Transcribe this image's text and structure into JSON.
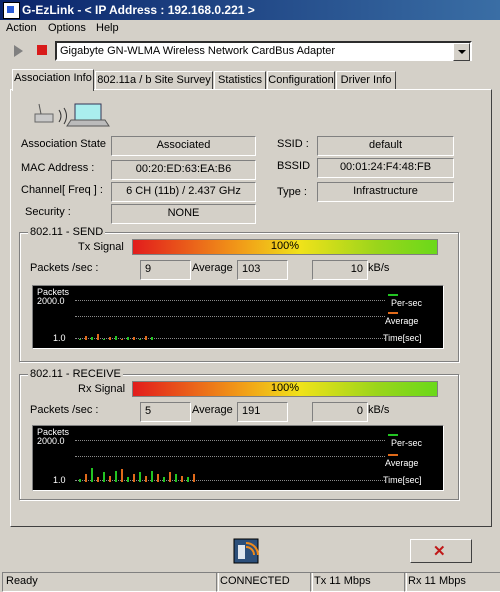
{
  "window": {
    "title": "G-EzLink  -  < IP Address : 192.168.0.221  >"
  },
  "menu": [
    "Action",
    "Options",
    "Help"
  ],
  "toolbar": {
    "adapter": "Gigabyte GN-WLMA Wireless Network CardBus Adapter"
  },
  "tabs": [
    "Association Info",
    "802.11a / b Site Survey",
    "Statistics",
    "Configuration",
    "Driver Info"
  ],
  "association": {
    "state_label": "Association State",
    "state": "Associated",
    "mac_label": "MAC Address :",
    "mac": "00:20:ED:63:EA:B6",
    "channel_label": "Channel[ Freq ] :",
    "channel": "6 CH (11b) / 2.437 GHz",
    "security_label": "Security :",
    "security": "NONE",
    "ssid_label": "SSID :",
    "ssid": "default",
    "bssid_label": "BSSID",
    "bssid": "00:01:24:F4:48:FB",
    "type_label": "Type :",
    "type": "Infrastructure"
  },
  "send": {
    "group_title": "802.11 - SEND",
    "signal_label": "Tx Signal",
    "signal_pct": "100%",
    "signal_value": 100,
    "packets_label": "Packets /sec :",
    "packets": "9",
    "average_label": "Average",
    "average": "103",
    "rate": "10",
    "rate_unit": "kB/s",
    "graph": {
      "y_title": "Packets",
      "y_max": "2000.0",
      "y_min": "1.0",
      "legend_persec": "Per-sec",
      "legend_avg": "Average",
      "x_label": "Time[sec]",
      "bars": [
        1,
        3,
        2,
        4,
        1,
        2,
        3,
        1,
        2,
        2,
        1,
        3,
        2
      ]
    }
  },
  "receive": {
    "group_title": "802.11 - RECEIVE",
    "signal_label": "Rx Signal",
    "signal_pct": "100%",
    "signal_value": 100,
    "packets_label": "Packets /sec :",
    "packets": "5",
    "average_label": "Average",
    "average": "191",
    "rate": "0",
    "rate_unit": "kB/s",
    "graph": {
      "y_title": "Packets",
      "y_max": "2000.0",
      "y_min": "1.0",
      "legend_persec": "Per-sec",
      "legend_avg": "Average",
      "x_label": "Time[sec]",
      "bars": [
        2,
        5,
        9,
        3,
        6,
        4,
        7,
        8,
        3,
        5,
        6,
        4,
        7,
        5,
        3,
        6,
        5,
        4,
        3,
        5
      ]
    }
  },
  "status": {
    "ready": "Ready",
    "connection": "CONNECTED",
    "tx": "Tx 11 Mbps",
    "rx": "Rx 11 Mbps"
  },
  "colors": {
    "title_bar": "#0a246a",
    "legend_persec": "#22c422",
    "legend_avg": "#e06a1a",
    "close_x": "#c01818"
  }
}
